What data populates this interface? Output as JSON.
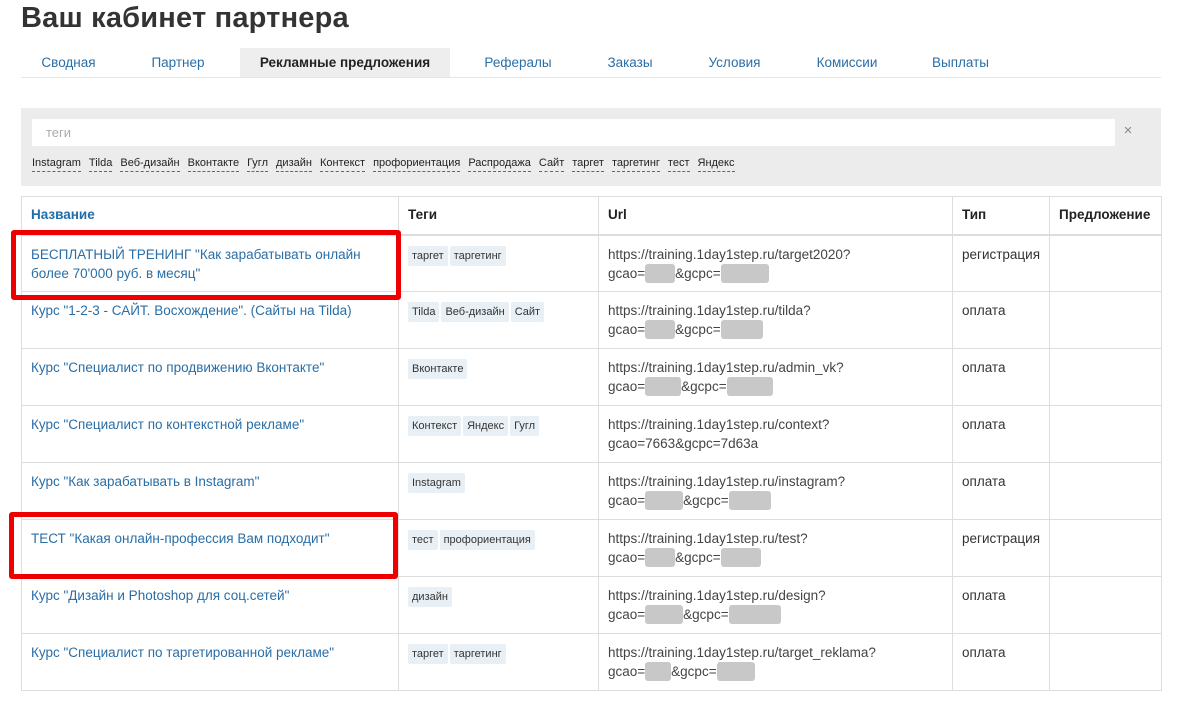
{
  "page_title": "Ваш кабинет партнера",
  "tabs": [
    {
      "label": "Сводная",
      "active": false
    },
    {
      "label": "Партнер",
      "active": false
    },
    {
      "label": "Рекламные предложения",
      "active": true
    },
    {
      "label": "Рефералы",
      "active": false
    },
    {
      "label": "Заказы",
      "active": false
    },
    {
      "label": "Условия",
      "active": false
    },
    {
      "label": "Комиссии",
      "active": false
    },
    {
      "label": "Выплаты",
      "active": false
    }
  ],
  "filter": {
    "placeholder": "теги",
    "clear_icon": "×",
    "tags": [
      "Instagram",
      "Tilda",
      "Веб-дизайн",
      "Вконтакте",
      "Гугл",
      "дизайн",
      "Контекст",
      "профориентация",
      "Распродажа",
      "Сайт",
      "таргет",
      "таргетинг",
      "тест",
      "Яндекс"
    ]
  },
  "table": {
    "headers": [
      "Название",
      "Теги",
      "Url",
      "Тип",
      "Предложение"
    ],
    "rows": [
      {
        "name": "БЕСПЛАТНЫЙ ТРЕНИНГ \"Как зарабатывать онлайн более 70'000 руб. в месяц\"",
        "tags": [
          "таргет",
          "таргетинг"
        ],
        "url_line1": "https://training.1day1step.ru/target2020?",
        "url_line2": "gcao=&gcpc=",
        "type": "регистрация",
        "offer": ""
      },
      {
        "name": "Курс \"1-2-3 - САЙТ. Восхождение\". (Сайты на Tilda)",
        "tags": [
          "Tilda",
          "Веб-дизайн",
          "Сайт"
        ],
        "url_line1": "https://training.1day1step.ru/tilda?",
        "url_line2": "gcao=&gcpc=",
        "type": "оплата",
        "offer": ""
      },
      {
        "name": "Курс \"Специалист по продвижению Вконтакте\"",
        "tags": [
          "Вконтакте"
        ],
        "url_line1": "https://training.1day1step.ru/admin_vk?",
        "url_line2": "gcao=&gcpc=",
        "type": "оплата",
        "offer": ""
      },
      {
        "name": "Курс \"Специалист по контекстной рекламе\"",
        "tags": [
          "Контекст",
          "Яндекс",
          "Гугл"
        ],
        "url_line1": "https://training.1day1step.ru/context?",
        "url_line2": "gcao=7663&gcpc=7d63a",
        "type": "оплата",
        "offer": ""
      },
      {
        "name": "Курс \"Как зарабатывать в Instagram\"",
        "tags": [
          "Instagram"
        ],
        "url_line1": "https://training.1day1step.ru/instagram?",
        "url_line2": "gcao=&gcpc=",
        "type": "оплата",
        "offer": ""
      },
      {
        "name": "ТЕСТ \"Какая онлайн-профессия Вам подходит\"",
        "tags": [
          "тест",
          "профориентация"
        ],
        "url_line1": "https://training.1day1step.ru/test?",
        "url_line2": "gcao=&gcpc=",
        "type": "регистрация",
        "offer": ""
      },
      {
        "name": "Курс \"Дизайн и Photoshop для соц.сетей\"",
        "tags": [
          "дизайн"
        ],
        "url_line1": "https://training.1day1step.ru/design?",
        "url_line2": "gcao=&gcpc=",
        "type": "оплата",
        "offer": ""
      },
      {
        "name": "Курс \"Специалист по таргетированной рекламе\"",
        "tags": [
          "таргет",
          "таргетинг"
        ],
        "url_line1": "https://training.1day1step.ru/target_reklama?",
        "url_line2": "gcao=&gcpc=",
        "type": "оплата",
        "offer": ""
      }
    ]
  },
  "colors": {
    "link": "#2a6ea6",
    "highlight": "#ee0000",
    "filter_bg": "#ececec",
    "chip_bg": "#e8f0f6",
    "redaction": "#c8c8c8"
  }
}
